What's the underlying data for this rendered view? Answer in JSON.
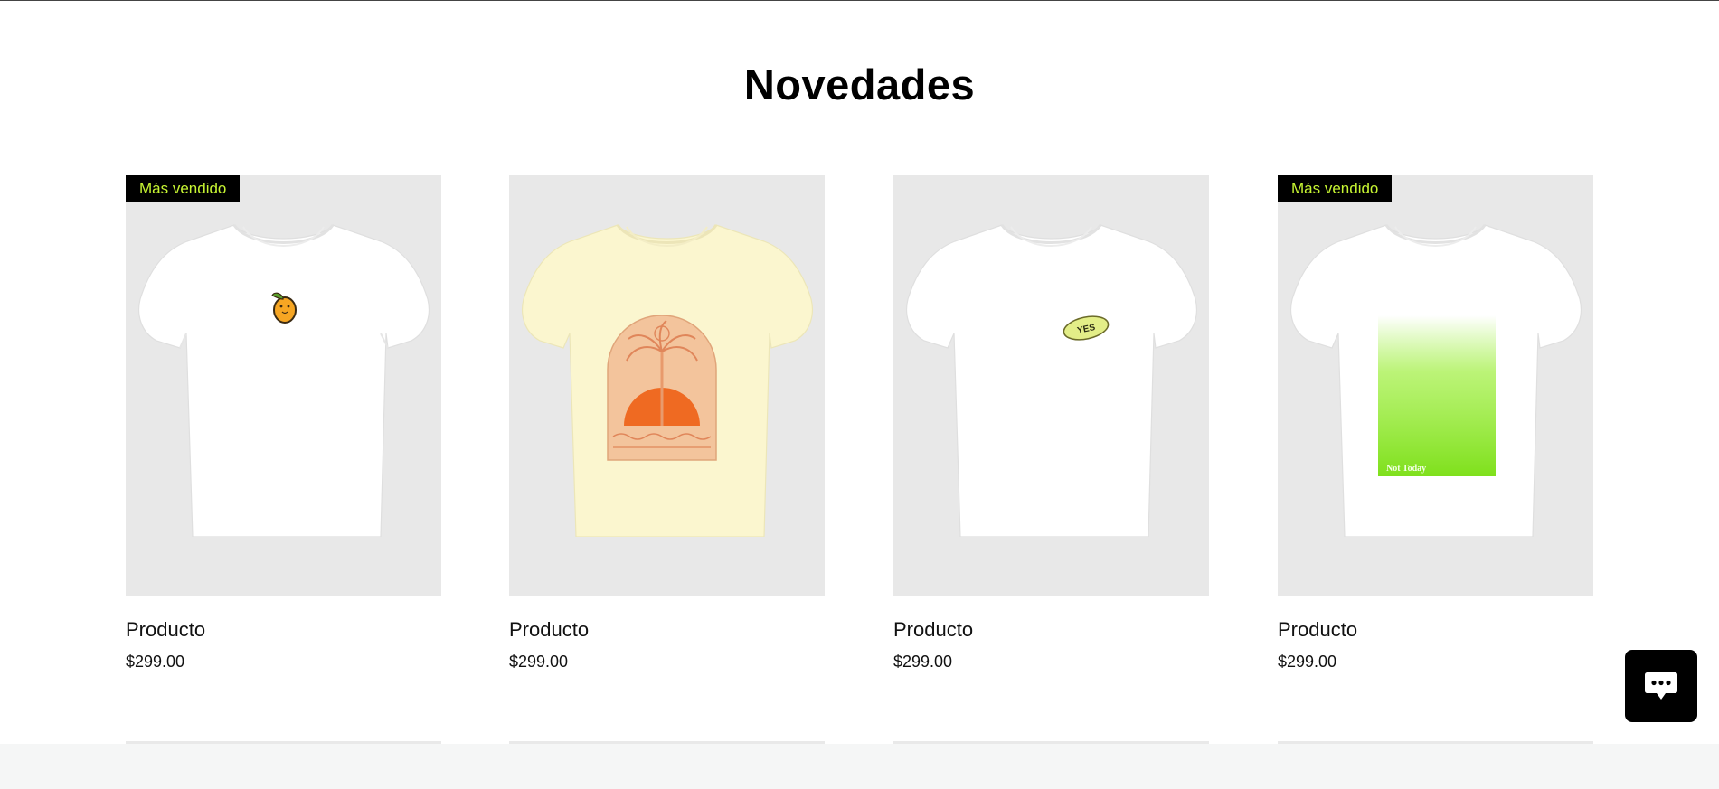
{
  "section": {
    "title": "Novedades"
  },
  "colors": {
    "badge_bg": "#000000",
    "badge_text": "#c6f432",
    "card_bg": "#e8e8e8",
    "chat_button_bg": "#000000"
  },
  "products": [
    {
      "name": "Producto",
      "price": "$299.00",
      "badge": "Más vendido",
      "shirt_color": "#ffffff",
      "print": "mango-icon"
    },
    {
      "name": "Producto",
      "price": "$299.00",
      "badge": "",
      "shirt_color": "#fbf6cf",
      "print": "palm-sunset-arch"
    },
    {
      "name": "Producto",
      "price": "$299.00",
      "badge": "",
      "shirt_color": "#ffffff",
      "print": "yes-oval",
      "print_text": "YES"
    },
    {
      "name": "Producto",
      "price": "$299.00",
      "badge": "Más vendido",
      "shirt_color": "#ffffff",
      "print": "green-gradient-panel",
      "print_text": "Not Today"
    }
  ],
  "chat": {
    "icon": "chat-bubble-icon"
  }
}
